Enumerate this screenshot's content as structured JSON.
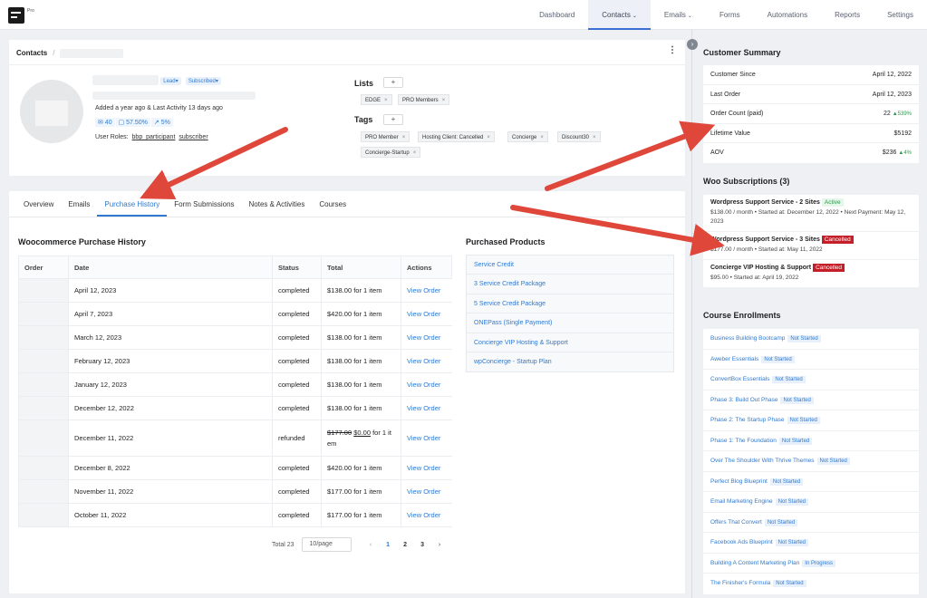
{
  "topbar": {
    "logo_text": "Pro",
    "nav": [
      {
        "label": "Dashboard",
        "caret": false,
        "active": false
      },
      {
        "label": "Contacts",
        "caret": true,
        "active": true
      },
      {
        "label": "Emails",
        "caret": true,
        "active": false
      },
      {
        "label": "Forms",
        "caret": false,
        "active": false
      },
      {
        "label": "Automations",
        "caret": false,
        "active": false
      },
      {
        "label": "Reports",
        "caret": false,
        "active": false
      },
      {
        "label": "Settings",
        "caret": false,
        "active": false
      }
    ]
  },
  "profile": {
    "breadcrumb": "Contacts",
    "breadcrumb_sep": "/",
    "status_lead": "Lead",
    "status_subscribed": "Subscribed",
    "activity": "Added a year ago & Last Activity 13 days ago",
    "stats": [
      "✉ 40",
      "▢ 57.50%",
      "↗ 5%"
    ],
    "roles_label": "User Roles:",
    "roles": [
      "bbp_participant",
      "subscriber"
    ],
    "lists_title": "Lists",
    "lists": [
      "EDGE",
      "PRO Members"
    ],
    "tags_title": "Tags",
    "tags_row1": [
      "PRO Member",
      "Hosting Client: Cancelled",
      "Concierge",
      "Discount30"
    ],
    "tags_row2": [
      "Concierge-Startup"
    ]
  },
  "tabs": [
    "Overview",
    "Emails",
    "Purchase History",
    "Form Submissions",
    "Notes & Activities",
    "Courses"
  ],
  "purchase_history": {
    "title": "Woocommerce Purchase History",
    "columns": [
      "Order",
      "Date",
      "Status",
      "Total",
      "Actions"
    ],
    "rows": [
      {
        "date": "April 12, 2023",
        "status": "completed",
        "total": "$138.00 for 1 item",
        "action": "View Order"
      },
      {
        "date": "April 7, 2023",
        "status": "completed",
        "total": "$420.00 for 1 item",
        "action": "View Order"
      },
      {
        "date": "March 12, 2023",
        "status": "completed",
        "total": "$138.00 for 1 item",
        "action": "View Order"
      },
      {
        "date": "February 12, 2023",
        "status": "completed",
        "total": "$138.00 for 1 item",
        "action": "View Order"
      },
      {
        "date": "January 12, 2023",
        "status": "completed",
        "total": "$138.00 for 1 item",
        "action": "View Order"
      },
      {
        "date": "December 12, 2022",
        "status": "completed",
        "total": "$138.00 for 1 item",
        "action": "View Order"
      },
      {
        "date": "December 11, 2022",
        "status": "refunded",
        "total_old": "$177.00",
        "total_new": "$0.00",
        "total_suffix": "for 1 it em",
        "action": "View Order"
      },
      {
        "date": "December 8, 2022",
        "status": "completed",
        "total": "$420.00 for 1 item",
        "action": "View Order"
      },
      {
        "date": "November 11, 2022",
        "status": "completed",
        "total": "$177.00 for 1 item",
        "action": "View Order"
      },
      {
        "date": "October 11, 2022",
        "status": "completed",
        "total": "$177.00 for 1 item",
        "action": "View Order"
      }
    ],
    "pager": {
      "total": "Total 23",
      "per_page": "10/page",
      "pages": [
        "1",
        "2",
        "3"
      ],
      "current": "1"
    }
  },
  "purchased_products": {
    "title": "Purchased Products",
    "items": [
      "Service Credit",
      "3 Service Credit Package",
      "5 Service Credit Package",
      "ONEPass (Single Payment)",
      "Concierge VIP Hosting & Support",
      "wpConcierge - Startup Plan"
    ]
  },
  "customer_summary": {
    "title": "Customer Summary",
    "rows": [
      {
        "label": "Customer Since",
        "value": "April 12, 2022",
        "delta": ""
      },
      {
        "label": "Last Order",
        "value": "April 12, 2023",
        "delta": ""
      },
      {
        "label": "Order Count (paid)",
        "value": "22",
        "delta": "▲539%"
      },
      {
        "label": "Lifetime Value",
        "value": "$5192",
        "delta": ""
      },
      {
        "label": "AOV",
        "value": "$236",
        "delta": "▲4%"
      }
    ]
  },
  "subscriptions": {
    "title": "Woo Subscriptions (3)",
    "items": [
      {
        "name": "Wordpress Support Service - 2 Sites",
        "badge": "Active",
        "badge_type": "active",
        "detail": "$138.00 / month  •  Started at: December 12, 2022  •  Next Payment: May 12, 2023"
      },
      {
        "name": "Wordpress Support Service - 3 Sites",
        "badge": "Cancelled",
        "badge_type": "cancel",
        "detail": "$177.00 / month  •  Started at: May 11, 2022"
      },
      {
        "name": "Concierge VIP Hosting & Support",
        "badge": "Cancelled",
        "badge_type": "cancel",
        "detail": "$95.00  •  Started at: April 19, 2022"
      }
    ]
  },
  "courses": {
    "title": "Course Enrollments",
    "items": [
      {
        "name": "Business Building Bootcamp",
        "status": "Not Started"
      },
      {
        "name": "Aweber Essentials",
        "status": "Not Started"
      },
      {
        "name": "ConvertBox Essentials",
        "status": "Not Started"
      },
      {
        "name": "Phase 3: Build Out Phase",
        "status": "Not Started"
      },
      {
        "name": "Phase 2: The Startup Phase",
        "status": "Not Started"
      },
      {
        "name": "Phase 1: The Foundation",
        "status": "Not Started"
      },
      {
        "name": "Over The Shoulder With Thrive Themes",
        "status": "Not Started"
      },
      {
        "name": "Perfect Blog Blueprint",
        "status": "Not Started"
      },
      {
        "name": "Email Marketing Engine",
        "status": "Not Started"
      },
      {
        "name": "Offers That Convert",
        "status": "Not Started"
      },
      {
        "name": "Facebook Ads Blueprint",
        "status": "Not Started"
      },
      {
        "name": "Building A Content Marketing Plan",
        "status": "In Progress"
      },
      {
        "name": "The Finisher's Formula",
        "status": "Not Started"
      }
    ]
  },
  "colors": {
    "accent": "#2f7ad0",
    "arrow": "#e0473b",
    "cancelled": "#c41f28",
    "active": "#2a9a4a"
  }
}
